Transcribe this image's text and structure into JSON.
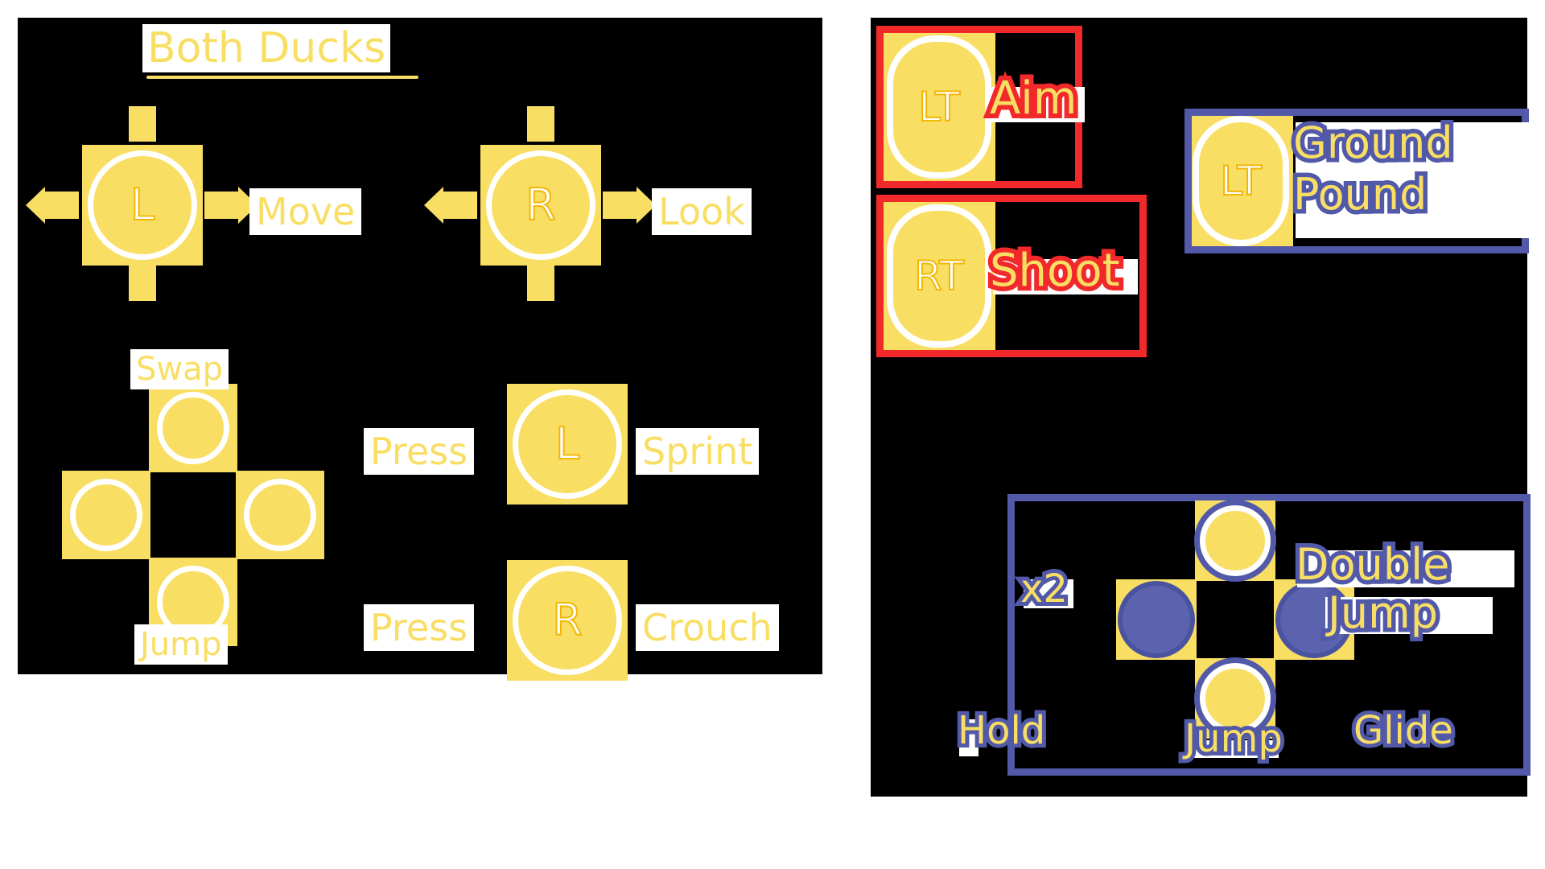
{
  "left_panel": {
    "title": "Both Ducks",
    "move": {
      "stick": "L",
      "label": "Move"
    },
    "look": {
      "stick": "R",
      "label": "Look"
    },
    "dpad": {
      "top_label": "Swap",
      "bottom_label": "Jump"
    },
    "sprint": {
      "prefix": "Press",
      "stick": "L",
      "label": "Sprint"
    },
    "crouch": {
      "prefix": "Press",
      "stick": "R",
      "label": "Crouch"
    }
  },
  "right_panel": {
    "aim": {
      "button": "LT",
      "label": "Aim"
    },
    "shoot": {
      "button": "RT",
      "label": "Shoot"
    },
    "ground_pound": {
      "button": "LT",
      "label_line1": "Ground",
      "label_line2": "Pound"
    },
    "double_jump": {
      "multiplier": "x2",
      "hold": "Hold",
      "jump": "Jump",
      "glide": "Glide",
      "label_line1": "Double",
      "label_line2": "Jump"
    }
  },
  "colors": {
    "background": "#000000",
    "yellow": "#F9DE64",
    "yellow_stroke": "#F2B705",
    "white": "#FFFFFF",
    "red": "#F2292B",
    "blue": "#5159A8",
    "blue_fill": "#5B63AE"
  }
}
